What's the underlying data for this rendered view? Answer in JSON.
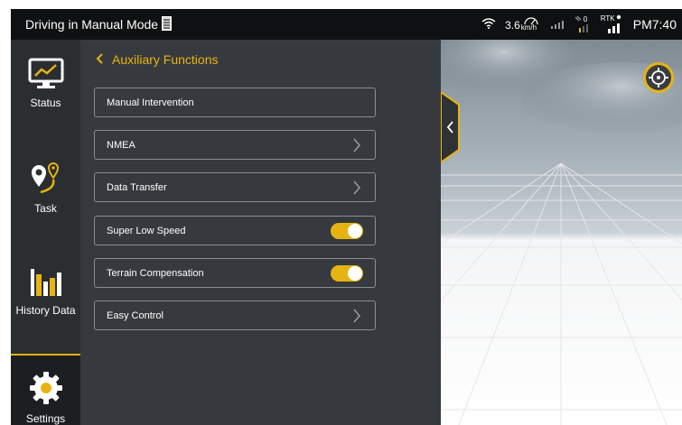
{
  "statusbar": {
    "title": "Driving in Manual Mode",
    "document_icon": "document-icon",
    "speed": "3.6",
    "speed_unit": "km/h",
    "rtk_label": "RTK",
    "satellite_count": "0",
    "time": "PM7:40"
  },
  "sidebar": {
    "items": [
      {
        "label": "Status",
        "icon": "monitor-chart-icon"
      },
      {
        "label": "Task",
        "icon": "route-pin-icon"
      },
      {
        "label": "History Data",
        "icon": "bar-chart-icon"
      },
      {
        "label": "Settings",
        "icon": "gear-icon",
        "active": true
      }
    ]
  },
  "panel": {
    "back_label": "Auxiliary Functions",
    "rows": [
      {
        "label": "Manual Intervention",
        "control": "none"
      },
      {
        "label": "NMEA",
        "control": "chevron"
      },
      {
        "label": "Data Transfer",
        "control": "chevron"
      },
      {
        "label": "Super Low Speed",
        "control": "toggle",
        "on": true
      },
      {
        "label": "Terrain Compensation",
        "control": "toggle",
        "on": true
      },
      {
        "label": "Easy Control",
        "control": "chevron"
      }
    ]
  },
  "colors": {
    "accent": "#e6b412",
    "panel": "#363a3e",
    "sidebar": "#2b2e31",
    "statusbar": "#0f1011"
  }
}
